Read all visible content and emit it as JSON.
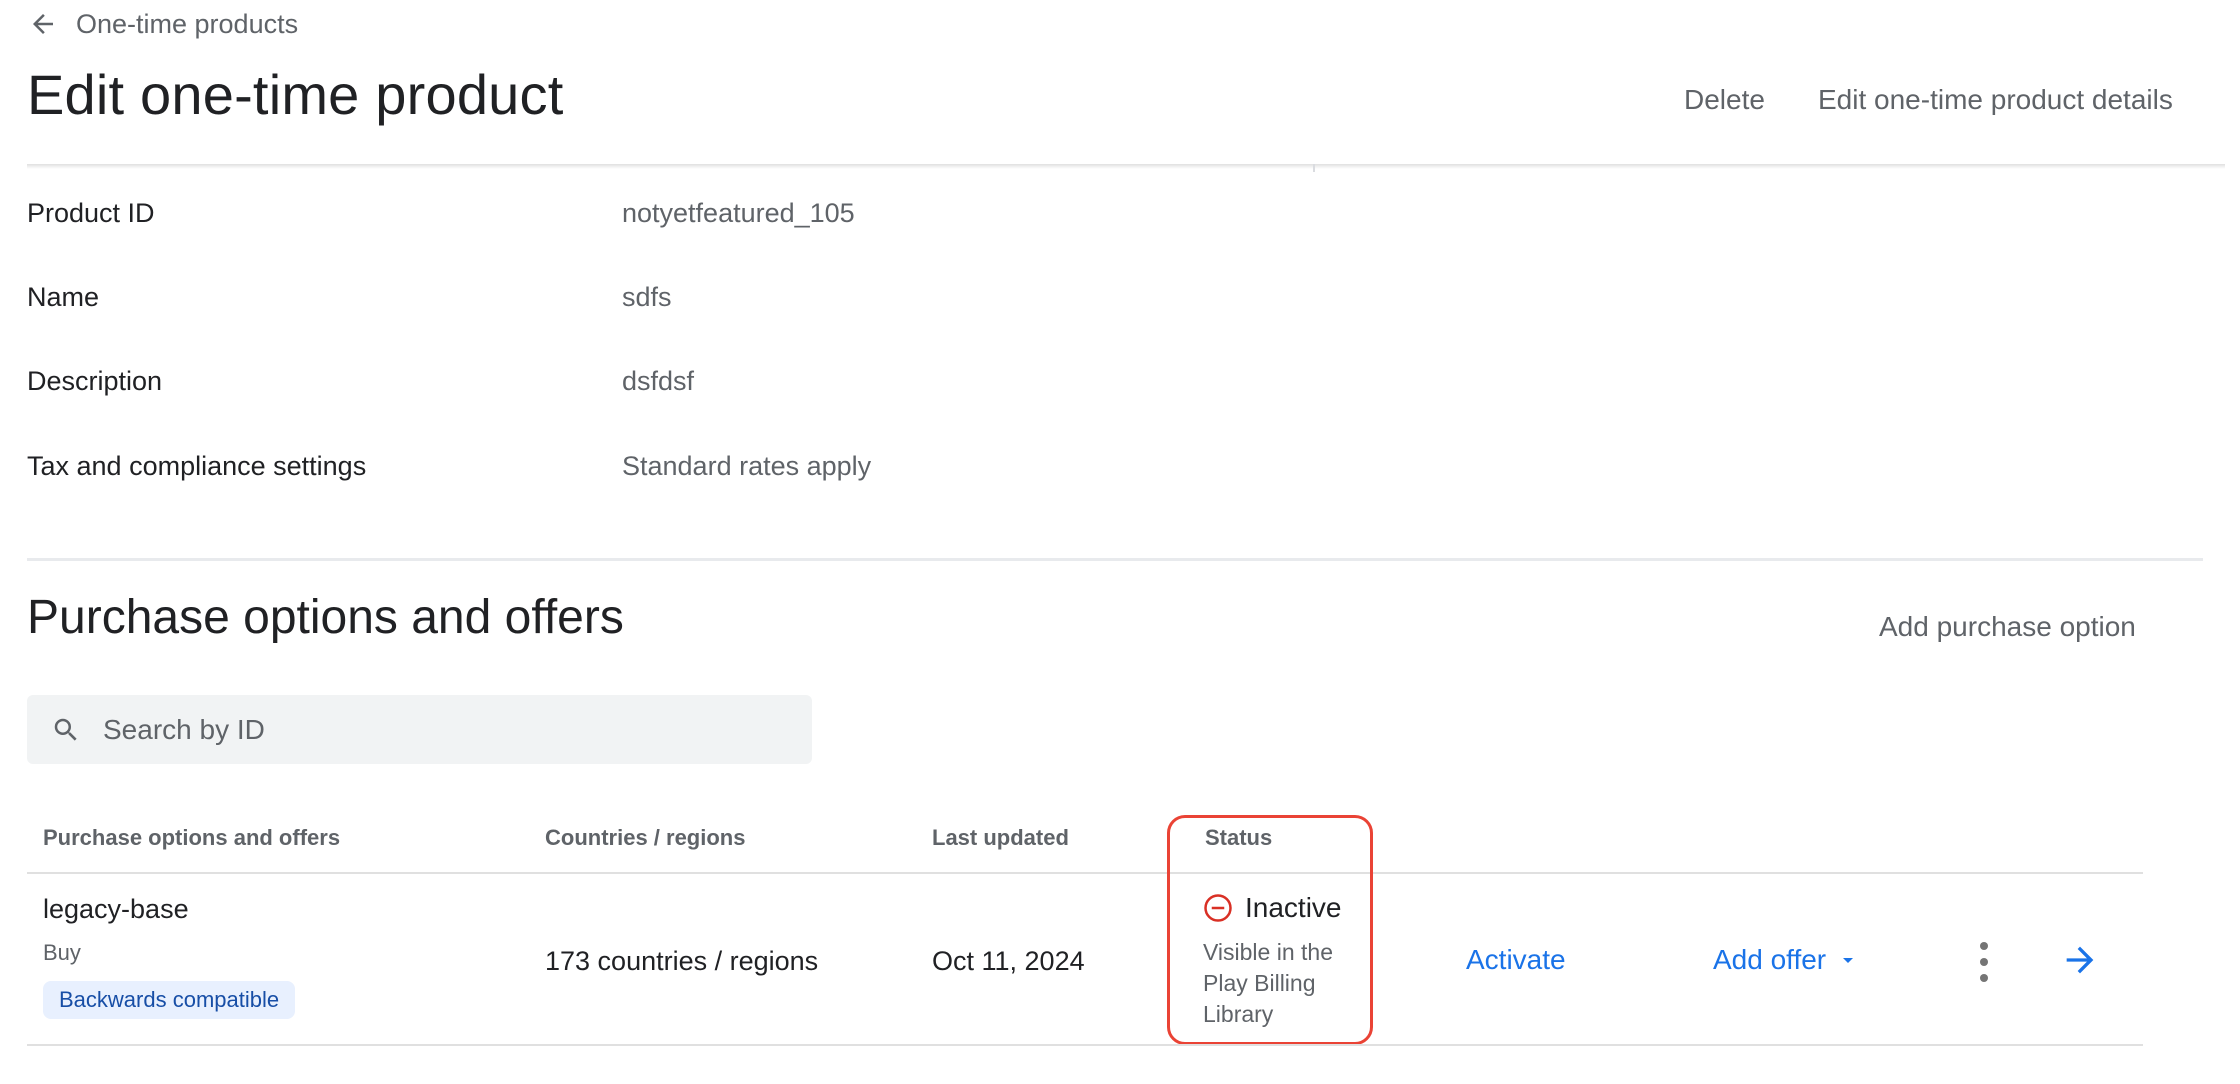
{
  "header": {
    "back_label": "One-time products",
    "title": "Edit one-time product",
    "actions": {
      "delete": "Delete",
      "edit_details": "Edit one-time product details"
    }
  },
  "details": [
    {
      "label": "Product ID",
      "value": "notyetfeatured_105"
    },
    {
      "label": "Name",
      "value": "sdfs"
    },
    {
      "label": "Description",
      "value": "dsfdsf"
    },
    {
      "label": "Tax and compliance settings",
      "value": "Standard rates apply"
    }
  ],
  "purchase_options": {
    "title": "Purchase options and offers",
    "add_button": "Add purchase option",
    "search_placeholder": "Search by ID",
    "columns": {
      "name": "Purchase options and offers",
      "countries": "Countries / regions",
      "updated": "Last updated",
      "status": "Status"
    },
    "rows": [
      {
        "id": "legacy-base",
        "type": "Buy",
        "badge": "Backwards compatible",
        "countries": "173 countries / regions",
        "updated": "Oct 11, 2024",
        "status": "Inactive",
        "status_note": "Visible in the Play Billing Library",
        "activate": "Activate",
        "add_offer": "Add offer"
      }
    ]
  },
  "colors": {
    "accent": "#1a73e8",
    "status_inactive": "#d93025",
    "highlight": "#ea4335"
  },
  "icons": [
    "arrow-back-icon",
    "search-icon",
    "remove-circle-icon",
    "dropdown-arrow-icon",
    "more-vert-icon",
    "arrow-forward-icon"
  ]
}
